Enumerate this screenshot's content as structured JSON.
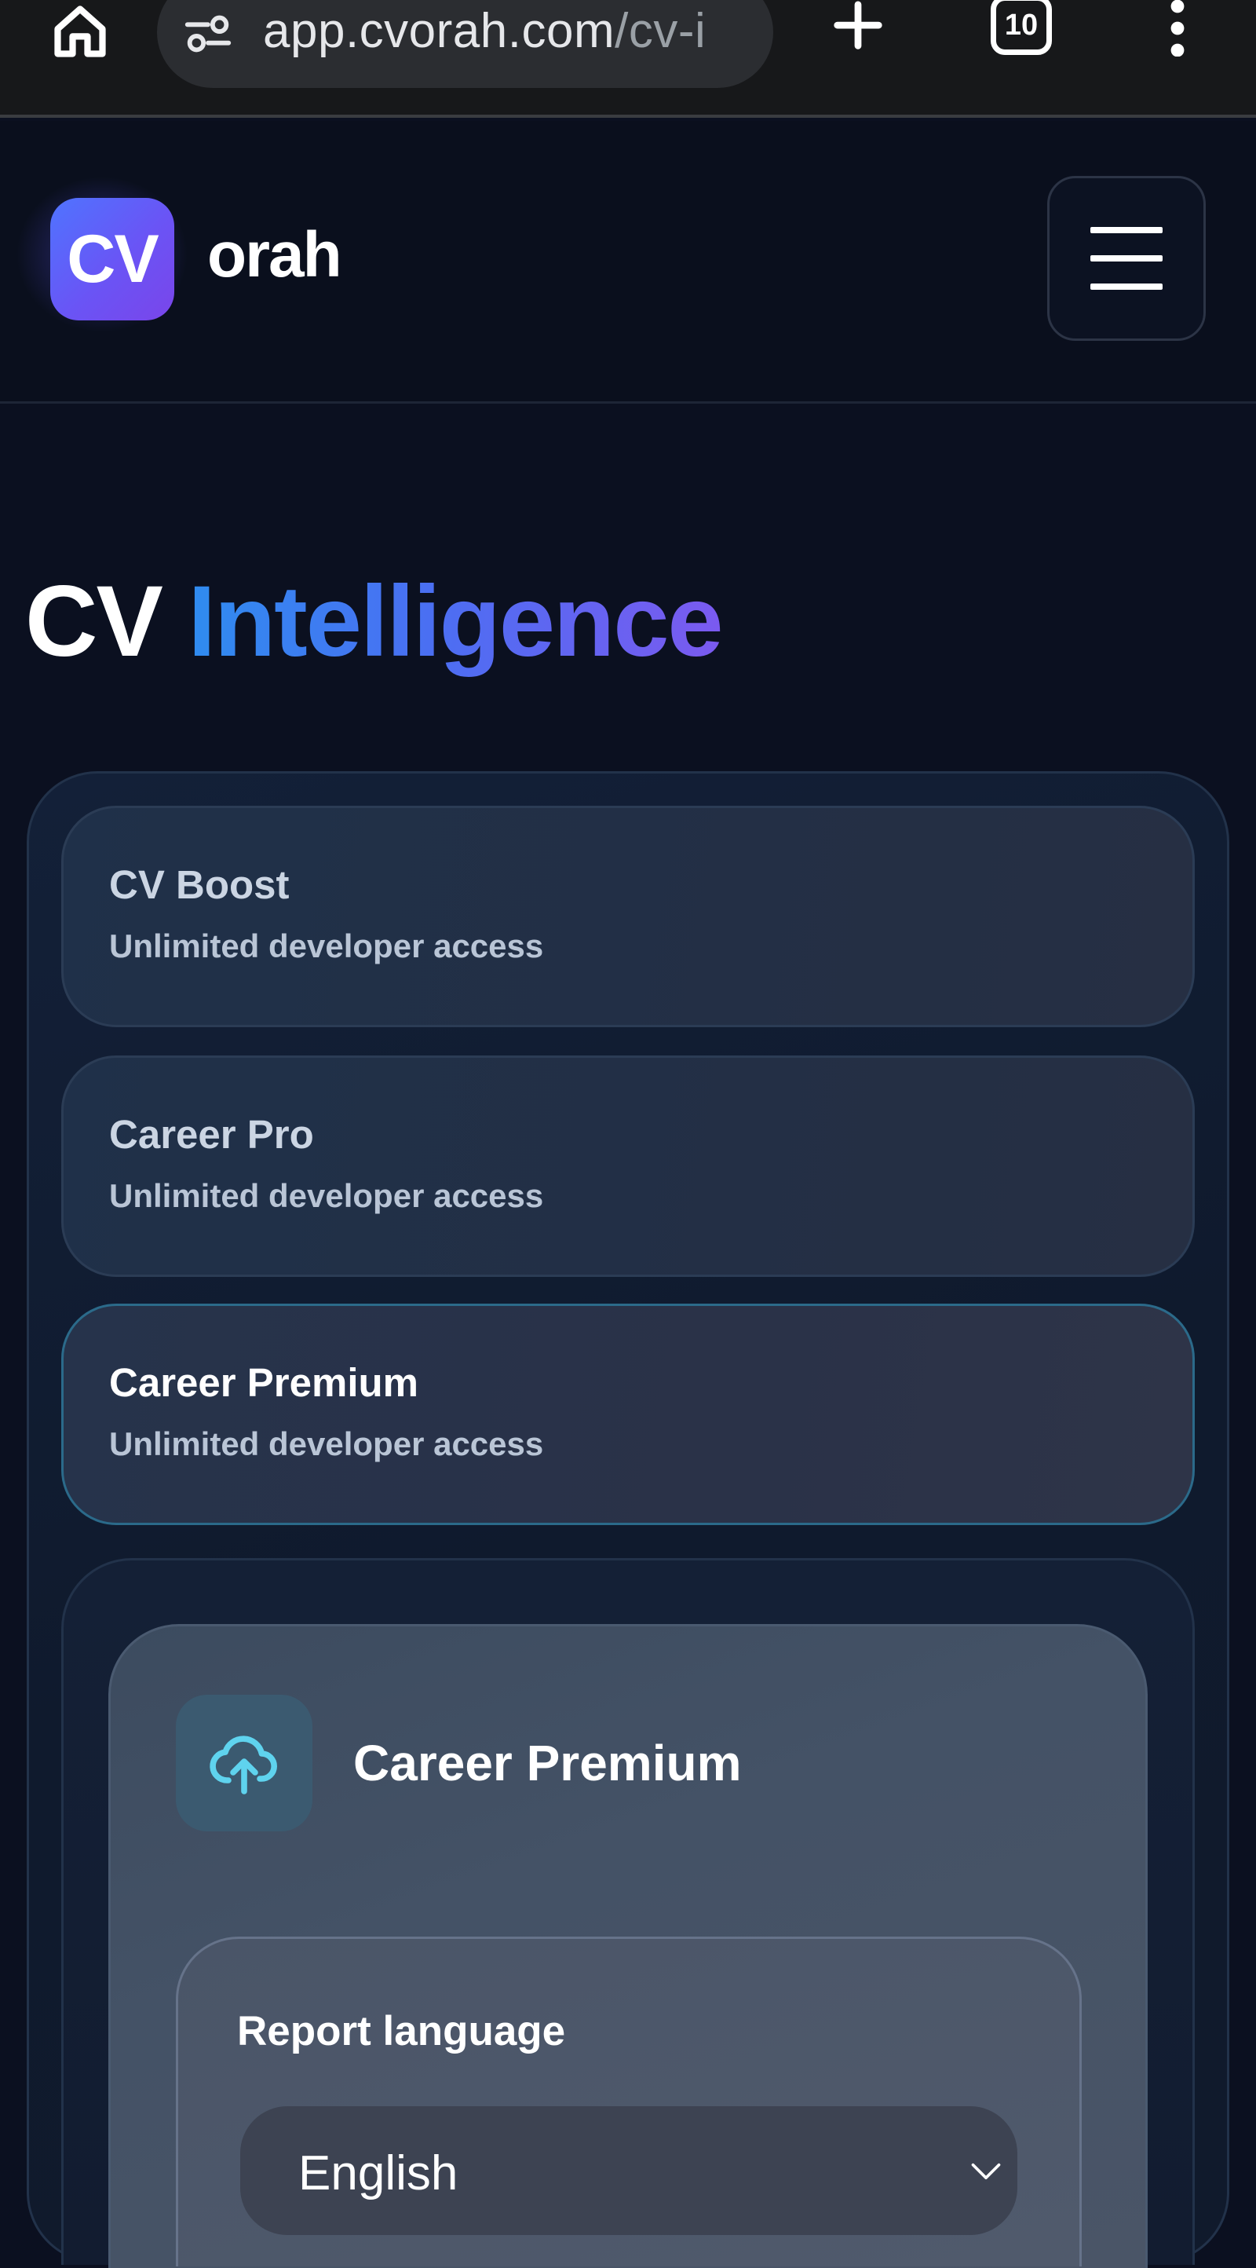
{
  "browser": {
    "url_main": "app.cvorah.com",
    "url_rest": "/cv-i",
    "tab_count": "10",
    "icons": [
      "home-icon",
      "site-settings-icon",
      "new-tab-icon",
      "tab-switcher-icon",
      "more-vert-icon"
    ]
  },
  "header": {
    "logo_badge": "CV",
    "logo_word": "orah",
    "menu_icon": "hamburger-icon",
    "brand_gradient": [
      "#4f74ff",
      "#7a45ea"
    ]
  },
  "page": {
    "title_part1": "CV",
    "title_part2": "Intelligence",
    "title_gradient": [
      "#2f8cf0",
      "#7b5af0"
    ]
  },
  "plans": [
    {
      "name": "CV Boost",
      "subtitle": "Unlimited developer access",
      "selected": false
    },
    {
      "name": "Career Pro",
      "subtitle": "Unlimited developer access",
      "selected": false
    },
    {
      "name": "Career Premium",
      "subtitle": "Unlimited developer access",
      "selected": true
    }
  ],
  "upload": {
    "icon": "cloud-upload-icon",
    "title": "Career Premium",
    "accent_color": "#5fd3ee"
  },
  "language": {
    "label": "Report language",
    "selected": "English"
  }
}
